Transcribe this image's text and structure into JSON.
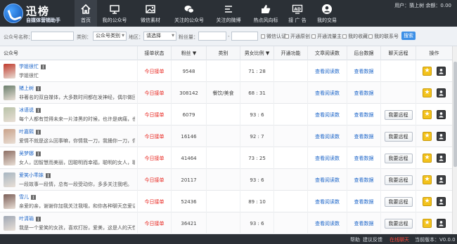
{
  "app": {
    "logo_title": "迅榜",
    "logo_sub": "自媒体营销助手",
    "user_line": "用户：猜上树  余额：0.00",
    "version": "当前版本：V0.0.0"
  },
  "nav": [
    {
      "label": "首页",
      "icon": "home-icon",
      "active": true
    },
    {
      "label": "我的公众号",
      "icon": "monitor-icon",
      "active": false
    },
    {
      "label": "微信素材",
      "icon": "image-icon",
      "active": false
    },
    {
      "label": "关注的公众号",
      "icon": "wechat-icon",
      "active": false
    },
    {
      "label": "关注的微博",
      "icon": "list-icon",
      "active": false
    },
    {
      "label": "热点风向标",
      "icon": "thumb-up-icon",
      "active": false
    },
    {
      "label": "接 广 告",
      "icon": "ad-icon",
      "active": false
    },
    {
      "label": "我的交易",
      "icon": "user-icon",
      "active": false
    }
  ],
  "filter": {
    "account_label": "公众号名称：",
    "account_placeholder": "",
    "category_label": "类别：",
    "category_value": "公众号类别",
    "region_label": "地区：",
    "region_value": "请选择",
    "fans_label": "粉丝量：",
    "fans_min": "",
    "fans_sep": "-",
    "fans_max": "",
    "checks": [
      "微信认证",
      "开通原创",
      "开通流量主",
      "我的收藏",
      "我的联系号"
    ],
    "search_label": "搜索"
  },
  "table": {
    "headers": [
      "公众号",
      "接单状态",
      "粉丝 ▼",
      "类别",
      "男女比例 ▼",
      "开通功能",
      "文章阅读数",
      "后台数据",
      "聊天远程",
      "操作"
    ],
    "rows": [
      {
        "name": "学姐很忙",
        "desc": "学姐很忙",
        "status": "今日接单",
        "fans": "9548",
        "category": "",
        "ratio": "71 : 28",
        "feature": "",
        "read": "查看阅读数",
        "backend": "查看数据",
        "chat": "",
        "avatar": "#c0392b"
      },
      {
        "name": "猪上树",
        "desc": "非著名的双自媒体，大多数时间都在发神经，偶尔做回人",
        "status": "今日接单",
        "fans": "308142",
        "category": "餐饮/美食",
        "ratio": "68 : 31",
        "feature": "",
        "read": "查看阅读数",
        "backend": "查看数据",
        "chat": "",
        "avatar": "#6a7f6d"
      },
      {
        "name": "冰语说",
        "desc": "每个人都有觉得未来一片漆黑的时候，也许是病痛，也许",
        "status": "今日接单",
        "fans": "6079",
        "category": "",
        "ratio": "93 : 6",
        "feature": "",
        "read": "查看阅读数",
        "backend": "查看数据",
        "chat": "我要远程",
        "avatar": "#b8c2a8"
      },
      {
        "name": "叶嘉熙",
        "desc": "爱情不就是这么回事嘛，你情我一刀，我捅你一刀，你捅",
        "status": "今日接单",
        "fans": "16146",
        "category": "",
        "ratio": "92 : 7",
        "feature": "",
        "read": "查看阅读数",
        "backend": "查看数据",
        "chat": "我要远程",
        "avatar": "#c9a28a"
      },
      {
        "name": "吴梦娜",
        "desc": "女人，因智慧而美丽，因聪明而幸福，聪明的女人，聪明",
        "status": "今日接单",
        "fans": "41464",
        "category": "",
        "ratio": "73 : 25",
        "feature": "",
        "read": "查看阅读数",
        "backend": "查看数据",
        "chat": "我要远程",
        "avatar": "#8d6e63"
      },
      {
        "name": "爱笑小乖妹",
        "desc": "一段故事一段情，总有一段受动你，多多关注我吧。",
        "status": "今日接单",
        "fans": "20117",
        "category": "",
        "ratio": "93 : 6",
        "feature": "",
        "read": "查看阅读数",
        "backend": "查看数据",
        "chat": "我要远程",
        "avatar": "#a7b6c2"
      },
      {
        "name": "雪儿",
        "desc": "亲爱的亲，谢谢你加我关注我哦，和你各种聊天恋爱话",
        "status": "今日接单",
        "fans": "52436",
        "category": "",
        "ratio": "89 : 10",
        "feature": "",
        "read": "查看阅读数",
        "backend": "查看数据",
        "chat": "我要远程",
        "avatar": "#7b5e57"
      },
      {
        "name": "叶清瑜",
        "desc": "我是一个爱笑的女孩，喜欢打扮，爱美，这是人的天性，",
        "status": "今日接单",
        "fans": "36421",
        "category": "",
        "ratio": "93 : 6",
        "feature": "",
        "read": "查看阅读数",
        "backend": "查看数据",
        "chat": "我要远程",
        "avatar": "#9fa8b5"
      }
    ]
  },
  "status": {
    "help": "帮助",
    "feedback": "建议反馈",
    "online_chat": "在线聊天"
  }
}
